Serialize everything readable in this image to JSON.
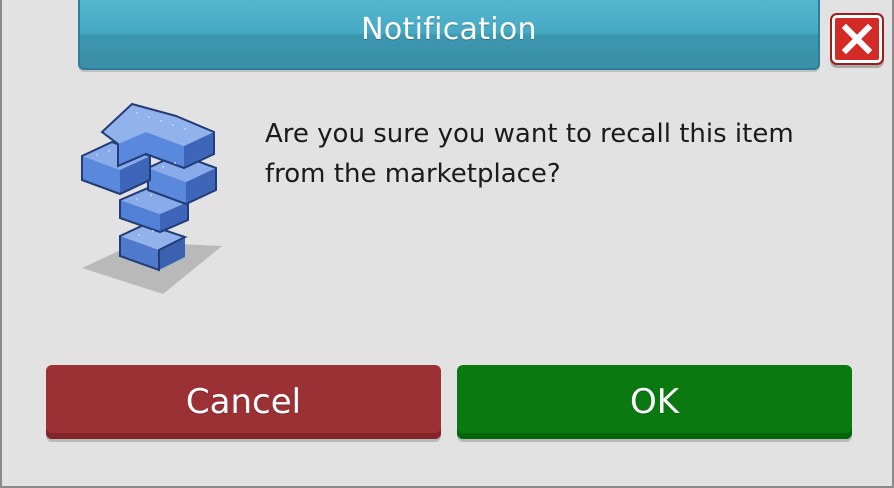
{
  "dialog": {
    "title": "Notification",
    "message": "Are you sure you want to recall this item from the marketplace?",
    "cancel_label": "Cancel",
    "ok_label": "OK"
  },
  "icons": {
    "close": "close-icon",
    "question": "question-mark-icon"
  },
  "colors": {
    "title_bar": "#46a9c3",
    "close_button": "#d42a27",
    "cancel_button": "#9c3135",
    "ok_button": "#0a7a10",
    "dialog_background": "#e2e2e2",
    "icon_blue": "#5b84d3"
  }
}
